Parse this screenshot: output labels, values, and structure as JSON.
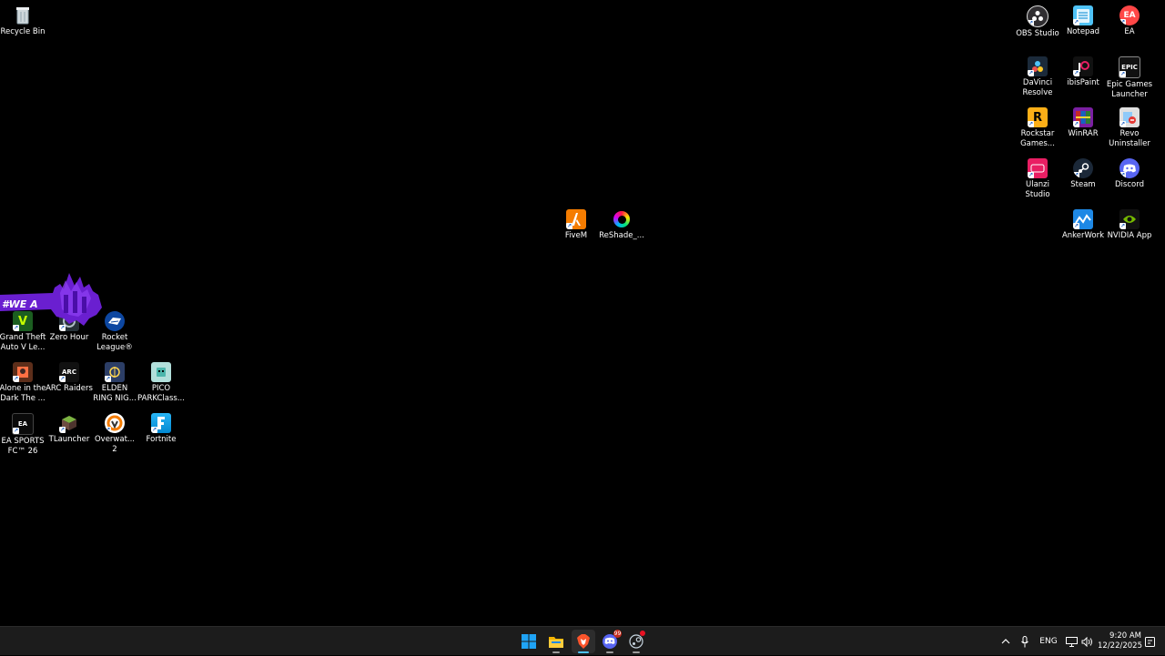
{
  "desktop": {
    "icons": {
      "recycle_bin": "Recycle Bin",
      "obs": "OBS Studio",
      "notepad": "Notepad",
      "ea": "EA",
      "davinci": "DaVinci\nResolve",
      "ibispaint": "ibisPaint",
      "epic": "Epic Games\nLauncher",
      "rockstar": "Rockstar\nGames...",
      "winrar": "WinRAR",
      "revo": "Revo\nUninstaller",
      "ulanzi": "Ulanzi\nStudio",
      "steam": "Steam",
      "discord": "Discord",
      "ankerwork": "AnkerWork",
      "nvidia": "NVIDIA App",
      "fivem": "FiveM",
      "reshade": "ReShade_...",
      "gta": "Grand Theft\nAuto V Le...",
      "zerohour": "Zero Hour",
      "rocketleague": "Rocket\nLeague®",
      "aloneinthedark": "Alone in the\nDark The ...",
      "arcraiders": "ARC Raiders",
      "eldenring": "ELDEN\nRING NIG...",
      "picopark": "PICO\nPARKClass...",
      "easportsfc": "EA SPORTS\nFC™ 26",
      "tlauncher": "TLauncher",
      "overwatch": "Overwat...\n2",
      "fortnite": "Fortnite"
    },
    "icon_glyphs": {
      "epic": "EPIC",
      "rockstar": "R",
      "arc": "ARC",
      "easports": "EA"
    },
    "banner_text": "#WE A"
  },
  "taskbar": {
    "discord_badge": "99",
    "tray": {
      "language": "ENG"
    },
    "clock": {
      "time": "9:20 AM",
      "date": "12/22/2025"
    }
  },
  "colors": {
    "desktop_bg": "#000000",
    "taskbar_bg": "#1c1c1c",
    "banner_purple": "#6a1fd0",
    "windows_blue": "#1fa3f5",
    "accent_underline": "#4cc2ff"
  }
}
